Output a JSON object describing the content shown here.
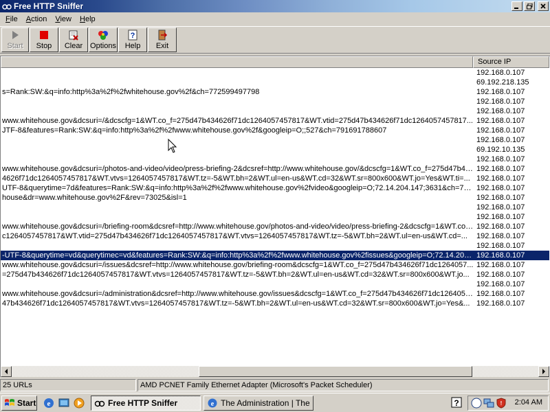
{
  "window": {
    "title": "Free HTTP Sniffer"
  },
  "menu": [
    {
      "label": "File",
      "key": "F",
      "rest": "ile"
    },
    {
      "label": "Action",
      "key": "A",
      "rest": "ction"
    },
    {
      "label": "View",
      "key": "V",
      "rest": "iew"
    },
    {
      "label": "Help",
      "key": "H",
      "rest": "elp"
    }
  ],
  "toolbar": {
    "start": "Start",
    "stop": "Stop",
    "clear": "Clear",
    "options": "Options",
    "help": "Help",
    "exit": "Exit"
  },
  "columns": {
    "col1": "",
    "source_ip": "Source IP"
  },
  "rows": [
    {
      "url": "",
      "ip": "192.168.0.107"
    },
    {
      "url": "",
      "ip": "69.192.218.135"
    },
    {
      "url": "s=Rank:SW:&q=info:http%3a%2f%2fwhitehouse.gov%2f&ch=772599497798",
      "ip": "192.168.0.107"
    },
    {
      "url": "",
      "ip": "192.168.0.107"
    },
    {
      "url": "",
      "ip": "192.168.0.107"
    },
    {
      "url": "www.whitehouse.gov&dcsuri=/&dcscfg=1&WT.co_f=275d47b434626f71dc1264057457817&WT.vtid=275d47b434626f71dc1264057457817...",
      "ip": "192.168.0.107"
    },
    {
      "url": "JTF-8&features=Rank:SW:&q=info:http%3a%2f%2fwww.whitehouse.gov%2f&googleip=O;;527&ch=791691788607",
      "ip": "192.168.0.107"
    },
    {
      "url": "",
      "ip": "192.168.0.107"
    },
    {
      "url": "",
      "ip": "69.192.10.135"
    },
    {
      "url": "",
      "ip": "192.168.0.107"
    },
    {
      "url": "www.whitehouse.gov&dcsuri=/photos-and-video/video/press-briefing-2&dcsref=http://www.whitehouse.gov/&dcscfg=1&WT.co_f=275d47b43...",
      "ip": "192.168.0.107"
    },
    {
      "url": "4626f71dc1264057457817&WT.vtvs=1264057457817&WT.tz=-5&WT.bh=2&WT.ul=en-us&WT.cd=32&WT.sr=800x600&WT.jo=Yes&WT.ti=...",
      "ip": "192.168.0.107"
    },
    {
      "url": "UTF-8&querytime=7d&features=Rank:SW:&q=info:http%3a%2f%2fwww.whitehouse.gov%2fvideo&googleip=O;72.14.204.147;3631&ch=77465...",
      "ip": "192.168.0.107"
    },
    {
      "url": "house&dr=www.whitehouse.gov%2F&rev=73025&isl=1",
      "ip": "192.168.0.107"
    },
    {
      "url": "",
      "ip": "192.168.0.107"
    },
    {
      "url": "",
      "ip": "192.168.0.107"
    },
    {
      "url": "www.whitehouse.gov&dcsuri=/briefing-room&dcsref=http://www.whitehouse.gov/photos-and-video/video/press-briefing-2&dcscfg=1&WT.co_...",
      "ip": "192.168.0.107"
    },
    {
      "url": "c1264057457817&WT.vtid=275d47b434626f71dc1264057457817&WT.vtvs=1264057457817&WT.tz=-5&WT.bh=2&WT.ul=en-us&WT.cd=...",
      "ip": "192.168.0.107"
    },
    {
      "url": "",
      "ip": "192.168.0.107"
    },
    {
      "url": "-UTF-8&querytime=vd&querytimec=vd&features=Rank:SW:&q=info:http%3a%2f%2fwww.whitehouse.gov%2fissues&googleip=O;72.14.204.147;...",
      "ip": "192.168.0.107",
      "selected": true
    },
    {
      "url": "www.whitehouse.gov&dcsuri=/issues&dcsref=http://www.whitehouse.gov/briefing-room&dcscfg=1&WT.co_f=275d47b434626f71dc1264057...",
      "ip": "192.168.0.107"
    },
    {
      "url": "=275d47b434626f71dc1264057457817&WT.vtvs=1264057457817&WT.tz=-5&WT.bh=2&WT.ul=en-us&WT.cd=32&WT.sr=800x600&WT.jo...",
      "ip": "192.168.0.107"
    },
    {
      "url": "",
      "ip": "192.168.0.107"
    },
    {
      "url": "www.whitehouse.gov&dcsuri=/administration&dcsref=http://www.whitehouse.gov/issues&dcscfg=1&WT.co_f=275d47b434626f71dc1264057...",
      "ip": "192.168.0.107"
    },
    {
      "url": "47b434626f71dc1264057457817&WT.vtvs=1264057457817&WT.tz=-5&WT.bh=2&WT.ul=en-us&WT.cd=32&WT.sr=800x600&WT.jo=Yes&...",
      "ip": "192.168.0.107"
    }
  ],
  "status": {
    "count": "25 URLs",
    "adapter": "AMD PCNET Family Ethernet Adapter (Microsoft's Packet Scheduler)"
  },
  "taskbar": {
    "start": "Start",
    "tasks": [
      {
        "label": "Free HTTP Sniffer",
        "active": true
      },
      {
        "label": "The Administration | The ...",
        "active": false
      }
    ],
    "clock": "2:04 AM"
  },
  "icons": {
    "app": "sniffer-glasses-icon",
    "start": "play-icon",
    "stop": "stop-square-icon",
    "clear": "clear-eraser-icon",
    "options": "options-shapes-icon",
    "help": "help-question-icon",
    "exit": "exit-door-icon"
  },
  "colors": {
    "selection": "#0a246a",
    "title_start": "#0a246a",
    "stop_red": "#e00000"
  }
}
